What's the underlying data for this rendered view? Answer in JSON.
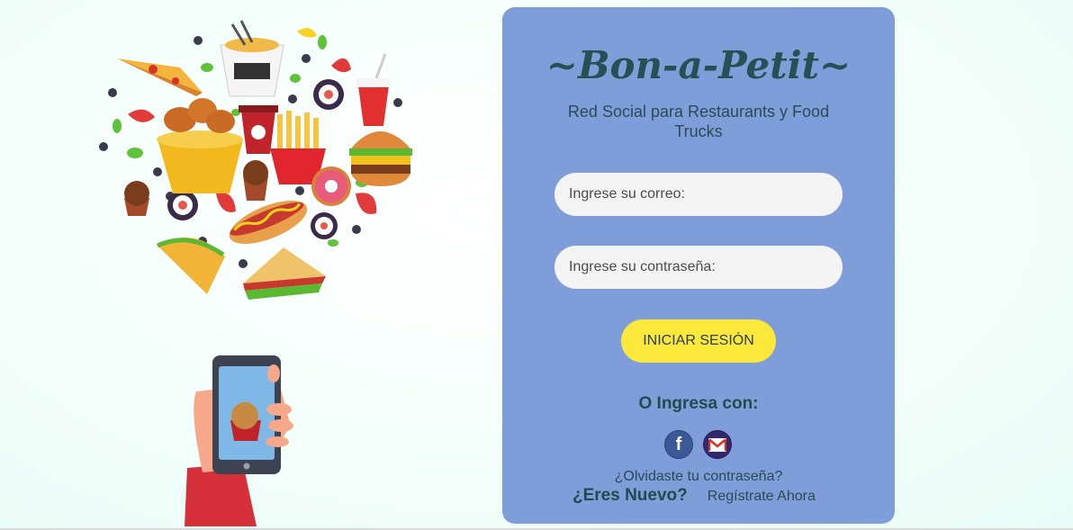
{
  "brand": {
    "name": "~Bon-a-Petit~",
    "tagline": "Red Social para Restaurants y Food Trucks"
  },
  "login": {
    "email_placeholder": "Ingrese su correo:",
    "password_placeholder": "Ingrese su contraseña:",
    "submit_label": "INICIAR SESIÓN"
  },
  "social": {
    "label": "O Ingresa con:",
    "providers": [
      {
        "name": "facebook",
        "icon": "facebook-icon",
        "glyph": "f"
      },
      {
        "name": "gmail",
        "icon": "gmail-icon"
      }
    ]
  },
  "links": {
    "forgot": "¿Olvidaste tu contraseña?",
    "new_question": "¿Eres Nuevo?",
    "register": "Regístrate Ahora"
  },
  "colors": {
    "card_bg": "#7f9ed9",
    "brand_text": "#274f54",
    "button_bg": "#fbe83a",
    "input_bg": "#f3f3f4"
  }
}
